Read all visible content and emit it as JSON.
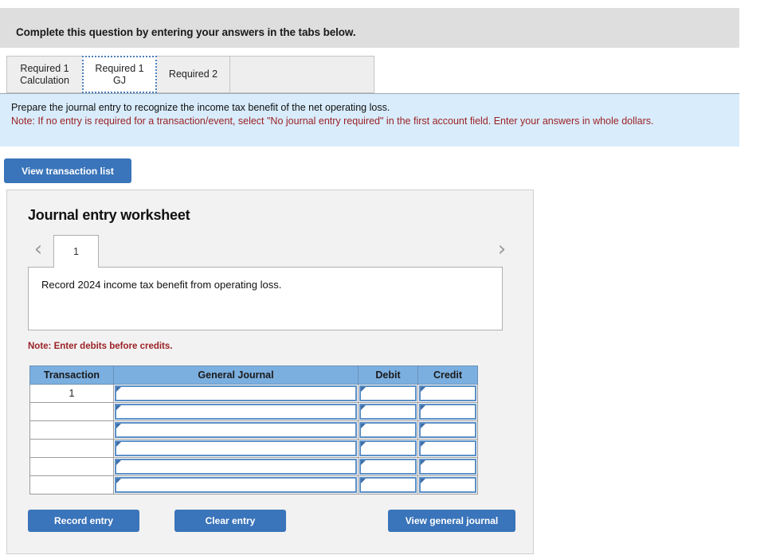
{
  "banner": {
    "text": "Complete this question by entering your answers in the tabs below."
  },
  "tabs": [
    {
      "label_line1": "Required 1",
      "label_line2": "Calculation",
      "active": false
    },
    {
      "label_line1": "Required 1 GJ",
      "label_line2": "",
      "active": true
    },
    {
      "label_line1": "Required 2",
      "label_line2": "",
      "active": false
    }
  ],
  "instructions": {
    "line1": "Prepare the journal entry to recognize the income tax benefit of the net operating loss.",
    "note": "Note: If no entry is required for a transaction/event, select \"No journal entry required\" in the first account field. Enter your answers in whole dollars."
  },
  "buttons": {
    "view_transaction_list": "View transaction list",
    "record_entry": "Record entry",
    "clear_entry": "Clear entry",
    "view_general_journal": "View general journal"
  },
  "worksheet": {
    "title": "Journal entry worksheet",
    "prev_icon": "chevron-left-icon",
    "next_icon": "chevron-right-icon",
    "page_tab_label": "1",
    "description": "Record 2024 income tax benefit from operating loss.",
    "debits_note": "Note: Enter debits before credits."
  },
  "table": {
    "headers": [
      "Transaction",
      "General Journal",
      "Debit",
      "Credit"
    ],
    "rows": [
      {
        "transaction": "1",
        "general_journal": "",
        "debit": "",
        "credit": ""
      },
      {
        "transaction": "",
        "general_journal": "",
        "debit": "",
        "credit": ""
      },
      {
        "transaction": "",
        "general_journal": "",
        "debit": "",
        "credit": ""
      },
      {
        "transaction": "",
        "general_journal": "",
        "debit": "",
        "credit": ""
      },
      {
        "transaction": "",
        "general_journal": "",
        "debit": "",
        "credit": ""
      },
      {
        "transaction": "",
        "general_journal": "",
        "debit": "",
        "credit": ""
      }
    ]
  },
  "colors": {
    "accent_blue": "#3a74ba",
    "header_blue": "#7bafe0",
    "panel_blue": "#d9ecfb",
    "banner_gray": "#dedede",
    "note_red": "#9b2226",
    "field_border": "#5b8fc7"
  }
}
